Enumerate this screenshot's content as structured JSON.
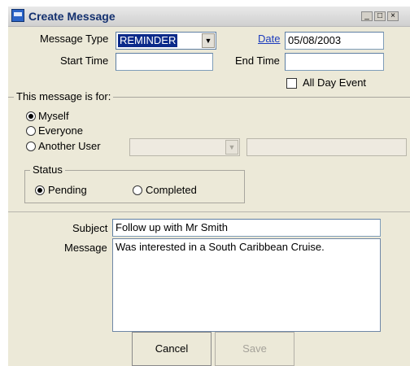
{
  "window": {
    "title": "Create Message",
    "title_buttons": [
      "_",
      "□",
      "×"
    ]
  },
  "form": {
    "message_type_label": "Message Type",
    "message_type_value": "REMINDER",
    "date_label": "Date",
    "date_value": "05/08/2003",
    "start_time_label": "Start Time",
    "start_time_value": "",
    "end_time_label": "End Time",
    "end_time_value": "",
    "all_day_label": "All Day Event",
    "message_for_label": "This message is for:",
    "options": [
      "Myself",
      "Everyone",
      "Another User"
    ],
    "selected_option": "Myself",
    "status_label": "Status",
    "status_options": [
      "Pending",
      "Completed"
    ],
    "selected_status": "Pending",
    "subject_label": "Subject",
    "subject_value": "Follow up with Mr Smith",
    "message_label": "Message",
    "message_value": "Was interested in a South Caribbean Cruise."
  },
  "buttons": {
    "cancel": "Cancel",
    "save": "Save"
  }
}
